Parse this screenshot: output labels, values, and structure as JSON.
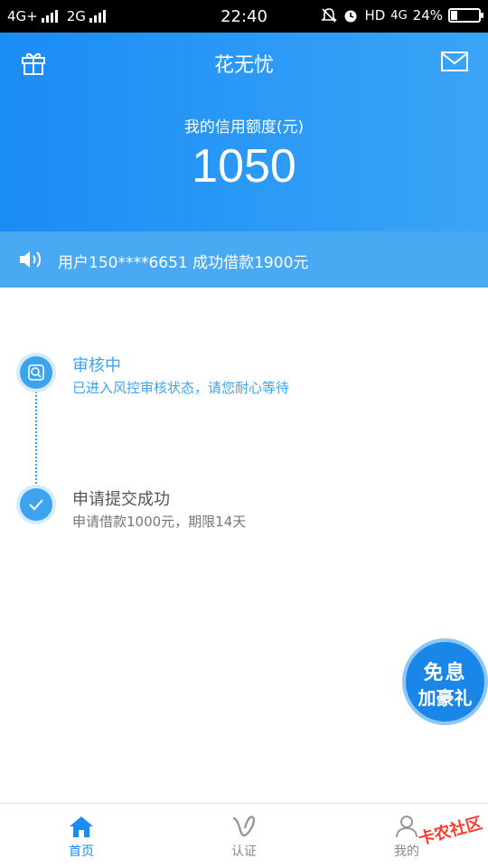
{
  "status_bar": {
    "network1": "4G+",
    "network2": "2G",
    "time": "22:40",
    "hd": "HD",
    "net_type": "4G",
    "battery": "24%",
    "battery_level": 0.24
  },
  "header": {
    "title": "花无忧",
    "credit_label": "我的信用额度(元)",
    "credit_amount": "1050"
  },
  "notice": {
    "text": "用户150****6651 成功借款1900元"
  },
  "steps": [
    {
      "title": "审核中",
      "desc": "已进入风控审核状态，请您耐心等待"
    },
    {
      "title": "申请提交成功",
      "desc": "申请借款1000元，期限14天"
    }
  ],
  "promo": {
    "line1": "免息",
    "line2": "加豪礼"
  },
  "nav": {
    "items": [
      {
        "label": "首页"
      },
      {
        "label": "认证"
      },
      {
        "label": "我的"
      }
    ]
  },
  "watermark": "卡农社区",
  "colors": {
    "primary": "#1a8cf5",
    "notice_bg": "#4aa9f3",
    "step_active": "#3ea3ef",
    "step_done_text": "#555555"
  }
}
